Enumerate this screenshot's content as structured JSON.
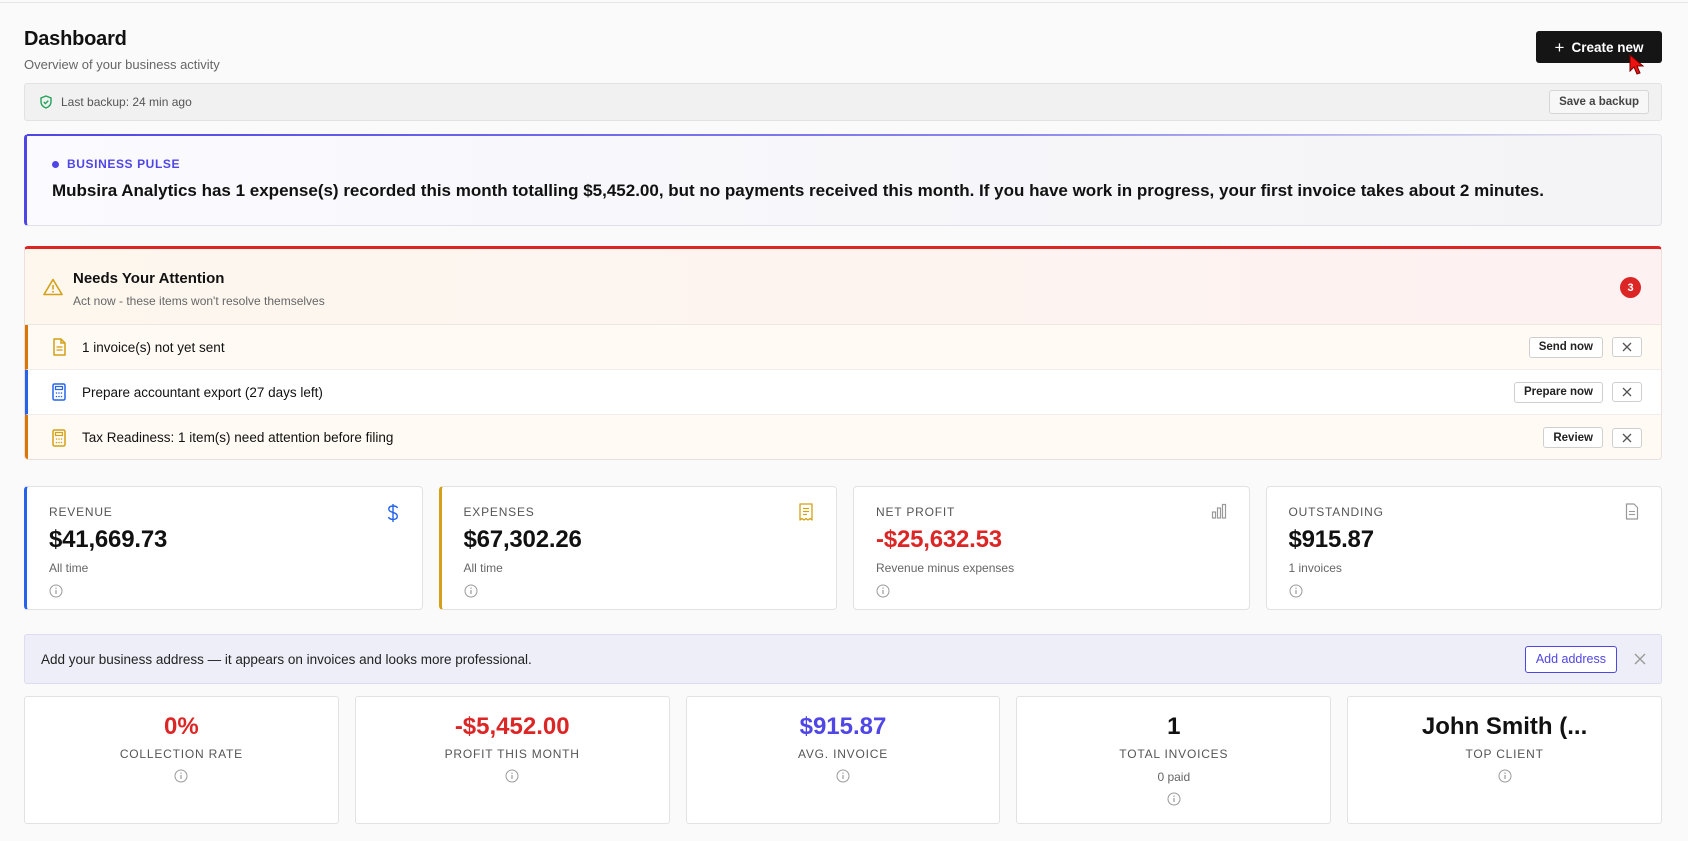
{
  "header": {
    "title": "Dashboard",
    "subtitle": "Overview of your business activity",
    "create_label": "Create new"
  },
  "backup": {
    "status": "Last backup: 24 min ago",
    "save_label": "Save a backup"
  },
  "pulse": {
    "tag": "BUSINESS PULSE",
    "message": "Mubsira Analytics has 1 expense(s) recorded this month totalling $5,452.00, but no payments received this month. If you have work in progress, your first invoice takes about 2 minutes."
  },
  "attention": {
    "title": "Needs Your Attention",
    "subtitle": "Act now - these items won't resolve themselves",
    "count": "3",
    "items": [
      {
        "text": "1 invoice(s) not yet sent",
        "action": "Send now",
        "icon": "document-icon",
        "color": "#d97706"
      },
      {
        "text": "Prepare accountant export (27 days left)",
        "action": "Prepare now",
        "icon": "calculator-icon",
        "color": "#2563eb"
      },
      {
        "text": "Tax Readiness: 1 item(s) need attention before filing",
        "action": "Review",
        "icon": "calculator-icon",
        "color": "#d97706"
      }
    ]
  },
  "stats": [
    {
      "label": "REVENUE",
      "value": "$41,669.73",
      "sub": "All time",
      "icon": "dollar-icon"
    },
    {
      "label": "EXPENSES",
      "value": "$67,302.26",
      "sub": "All time",
      "icon": "receipt-icon"
    },
    {
      "label": "NET PROFIT",
      "value": "-$25,632.53",
      "sub": "Revenue minus expenses",
      "icon": "bar-chart-icon"
    },
    {
      "label": "OUTSTANDING",
      "value": "$915.87",
      "sub": "1 invoices",
      "icon": "document-icon"
    }
  ],
  "address_banner": {
    "text": "Add your business address — it appears on invoices and looks more professional.",
    "button": "Add address"
  },
  "metrics": [
    {
      "value": "0%",
      "label": "COLLECTION RATE",
      "sub": ""
    },
    {
      "value": "-$5,452.00",
      "label": "PROFIT THIS MONTH",
      "sub": ""
    },
    {
      "value": "$915.87",
      "label": "AVG. INVOICE",
      "sub": ""
    },
    {
      "value": "1",
      "label": "TOTAL INVOICES",
      "sub": "0 paid"
    },
    {
      "value": "John Smith (...",
      "label": "TOP CLIENT",
      "sub": ""
    }
  ],
  "colors": {
    "accent": "#4f46e5",
    "danger": "#dc2626",
    "warning": "#d97706",
    "info": "#2563eb",
    "primary_button": "#151515"
  }
}
